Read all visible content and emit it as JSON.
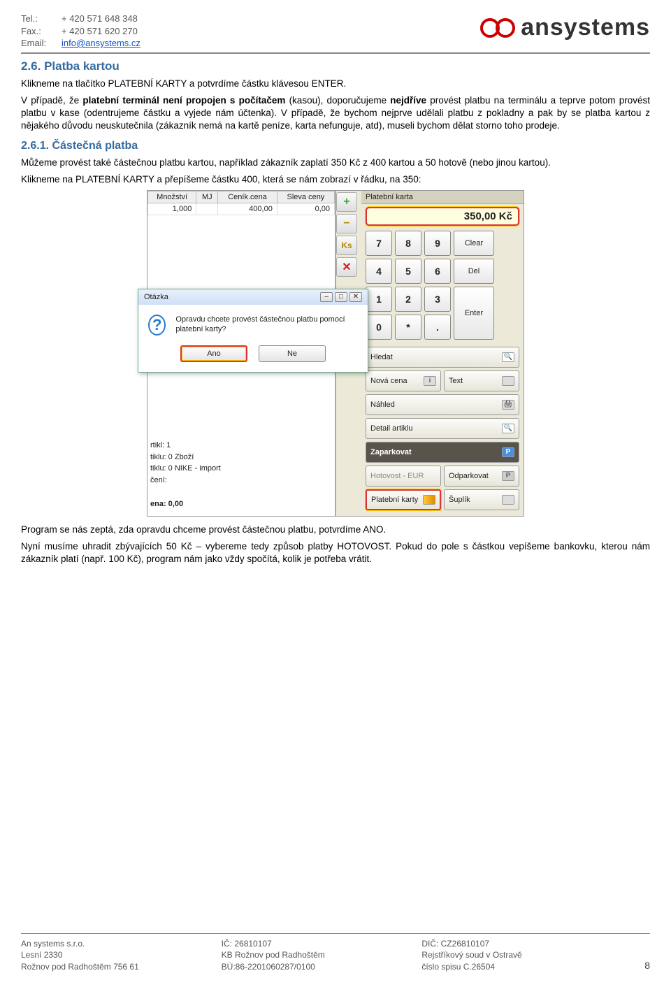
{
  "header": {
    "tel_label": "Tel.:",
    "tel": "+ 420 571 648 348",
    "fax_label": "Fax.:",
    "fax": "+ 420 571 620 270",
    "email_label": "Email:",
    "email": "info@ansystems.cz",
    "logo_text": "ansystems"
  },
  "section_26": {
    "title": "2.6. Platba kartou",
    "p1": "Klikneme na tlačítko PLATEBNÍ KARTY a potvrdíme částku klávesou ENTER.",
    "p2_pre": "V případě, že ",
    "p2_bold1": "platební terminál není propojen s počítačem",
    "p2_mid1": " (kasou), doporučujeme ",
    "p2_bold2": "nejdříve",
    "p2_mid2": " provést platbu na terminálu a teprve potom provést platbu v kase (odentrujeme částku a vyjede nám účtenka). V případě, že bychom nejprve udělali platbu z pokladny a pak by se platba kartou z nějakého důvodu neuskutečnila (zákazník nemá na kartě peníze, karta nefunguje, atd), museli bychom dělat storno toho prodeje."
  },
  "section_261": {
    "title": "2.6.1. Částečná platba",
    "p1": "Můžeme provést také částečnou platbu kartou, například zákazník zaplatí 350 Kč z 400 kartou a 50 hotově (nebo jinou kartou).",
    "p2": "Klikneme na PLATEBNÍ KARTY a přepíšeme částku 400, která se nám zobrazí v řádku, na 350:"
  },
  "screenshot": {
    "table": {
      "h1": "Množství",
      "h2": "MJ",
      "h3": "Ceník.cena",
      "h4": "Sleva ceny",
      "r_mnozstvi": "1,000",
      "r_cena": "400,00",
      "r_sleva": "0,00"
    },
    "strip": {
      "plus": "+",
      "minus": "−",
      "ks": "Ks",
      "x": "✕"
    },
    "dialog": {
      "title": "Otázka",
      "text": "Opravdu chcete provést částečnou platbu pomocí platební karty?",
      "yes": "Ano",
      "no": "Ne"
    },
    "bl": {
      "l1": "rtikl: 1",
      "l2": "tiklu: 0 Zboží",
      "l3": "tiklu: 0 NIKE - import",
      "l4": "čení:",
      "l5": "ena: 0,00"
    },
    "right": {
      "head": "Platební karta",
      "amount": "350,00 Kč",
      "keys": {
        "k7": "7",
        "k8": "8",
        "k9": "9",
        "clear": "Clear",
        "k4": "4",
        "k5": "5",
        "k6": "6",
        "del": "Del",
        "k1": "1",
        "k2": "2",
        "k3": "3",
        "enter": "Enter",
        "k0": "0",
        "kstar": "*",
        "kdot": "."
      },
      "btns": {
        "hledat": "Hledat",
        "i": "i",
        "nova": "Nová cena",
        "text": "Text",
        "nahled": "Náhled",
        "detail": "Detail artiklu",
        "zapark": "Zaparkovat",
        "p": "P",
        "hot": "Hotovost - EUR",
        "odpark": "Odparkovat",
        "karty": "Platební karty",
        "suplik": "Šuplík"
      }
    }
  },
  "after": {
    "p1": "Program se nás zeptá, zda opravdu chceme provést částečnou platbu, potvrdíme ANO.",
    "p2": "Nyní musíme uhradit zbývajících 50 Kč – vybereme tedy způsob platby HOTOVOST. Pokud do pole s částkou vepíšeme bankovku, kterou nám zákazník platí (např. 100 Kč), program nám jako vždy spočítá, kolik je potřeba vrátit."
  },
  "footer": {
    "c1l1": "An systems s.r.o.",
    "c1l2": "Lesní 2330",
    "c1l3": "Rožnov pod Radhoštěm 756 61",
    "c2l1": "IČ: 26810107",
    "c2l2": "KB Rožnov pod Radhoštěm",
    "c2l3": "BÚ:86-2201060287/0100",
    "c3l1": "DIČ: CZ26810107",
    "c3l2": "Rejstříkový soud v Ostravě",
    "c3l3": "číslo spisu C.26504",
    "page": "8"
  }
}
